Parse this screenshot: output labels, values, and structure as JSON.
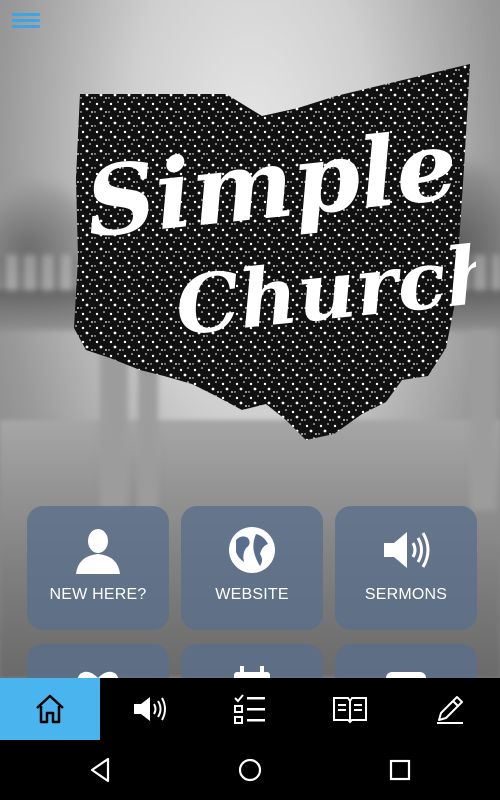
{
  "app": {
    "logo_text_line1": "Simple",
    "logo_text_line2": "Church"
  },
  "tiles": [
    {
      "label": "NEW HERE?",
      "icon": "person-icon"
    },
    {
      "label": "WEBSITE",
      "icon": "globe-icon"
    },
    {
      "label": "SERMONS",
      "icon": "speaker-icon"
    },
    {
      "label": "",
      "icon": "heart-icon"
    },
    {
      "label": "",
      "icon": "calendar-icon"
    },
    {
      "label": "",
      "icon": "tablet-icon"
    }
  ],
  "tabbar": [
    {
      "name": "home",
      "icon": "home-icon",
      "active": true
    },
    {
      "name": "sermons",
      "icon": "speaker-icon",
      "active": false
    },
    {
      "name": "checklist",
      "icon": "checklist-icon",
      "active": false
    },
    {
      "name": "bible",
      "icon": "book-icon",
      "active": false
    },
    {
      "name": "notes",
      "icon": "pencil-icon",
      "active": false
    }
  ],
  "colors": {
    "accent": "#49b4ee",
    "menu": "#3aa6e8",
    "tile_bg": "#586e8c"
  }
}
